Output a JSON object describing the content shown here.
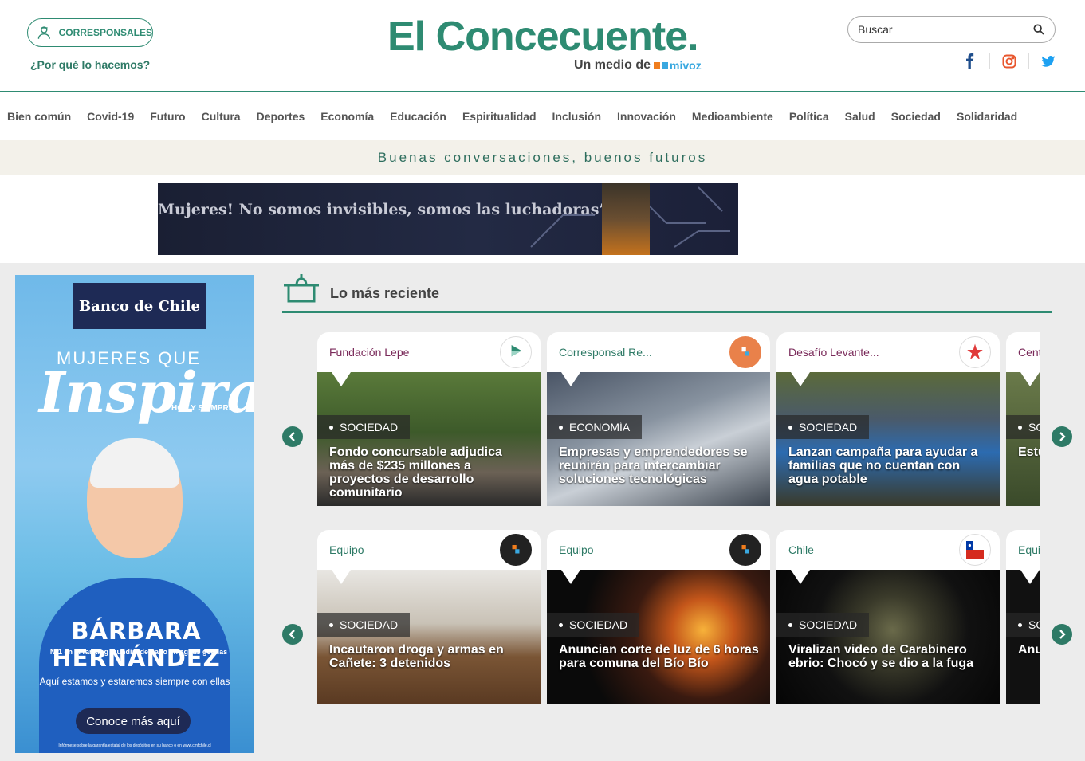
{
  "header": {
    "corresponsales_label": "CORRESPONSALES",
    "why_label": "¿Por qué lo hacemos?",
    "logo": "El Concecuente.",
    "medio_label": "Un medio de",
    "mivoz_label": "mivoz",
    "search_placeholder": "Buscar",
    "social": [
      "facebook-icon",
      "instagram-icon",
      "twitter-icon"
    ]
  },
  "nav": {
    "items": [
      "Bien común",
      "Covid-19",
      "Futuro",
      "Cultura",
      "Deportes",
      "Economía",
      "Educación",
      "Espiritualidad",
      "Inclusión",
      "Innovación",
      "Medioambiente",
      "Política",
      "Salud",
      "Sociedad",
      "Solidaridad"
    ]
  },
  "slogan": "Buenas conversaciones, buenos futuros",
  "top_banner": {
    "text": "Mujeres! No somos invisibles, somos las luchadoras”"
  },
  "side_ad": {
    "bank": "Banco de Chile",
    "headline_small": "MUJERES QUE",
    "headline_big": "Inspiran",
    "hoy": "HOY Y SIEMPRE",
    "name": "BÁRBARA HERNÁNDEZ",
    "ranking": "N°1 en el ranking mundial de nado en aguas gélidas",
    "aqui": "Aquí estamos y estaremos siempre con ellas",
    "cta": "Conoce más aquí",
    "fine": "Infórmese sobre la garantía estatal de los depósitos en su banco o en www.cmfchile.cl"
  },
  "recent": {
    "title": "Lo más reciente",
    "rows": [
      [
        {
          "source": "Fundación Lepe",
          "category": "SOCIEDAD",
          "title": "Fondo concursable adjudica más de $235 millones a proyectos de desarrollo comunitario"
        },
        {
          "source": "Corresponsal Re...",
          "category": "ECONOMÍA",
          "title": "Empresas y emprendedores se reunirán para intercambiar soluciones tecnológicas"
        },
        {
          "source": "Desafío Levante...",
          "category": "SOCIEDAD",
          "title": "Lanzan campaña para ayudar a familias que no cuentan con agua potable"
        },
        {
          "source": "Cent",
          "category": "SO",
          "title": "Estu la pr"
        }
      ],
      [
        {
          "source": "Equipo",
          "category": "SOCIEDAD",
          "title": "Incautaron droga y armas en Cañete: 3 detenidos"
        },
        {
          "source": "Equipo",
          "category": "SOCIEDAD",
          "title": "Anuncian corte de luz de 6 horas para comuna del Bío Bío"
        },
        {
          "source": "Chile",
          "category": "SOCIEDAD",
          "title": "Viralizan video de Carabinero ebrio: Chocó y se dio a la fuga"
        },
        {
          "source": "Equi",
          "category": "SO",
          "title": "Anu Áng"
        }
      ]
    ]
  },
  "colors": {
    "brand": "#2e8b72",
    "accent_source": "#7a2a5a"
  }
}
